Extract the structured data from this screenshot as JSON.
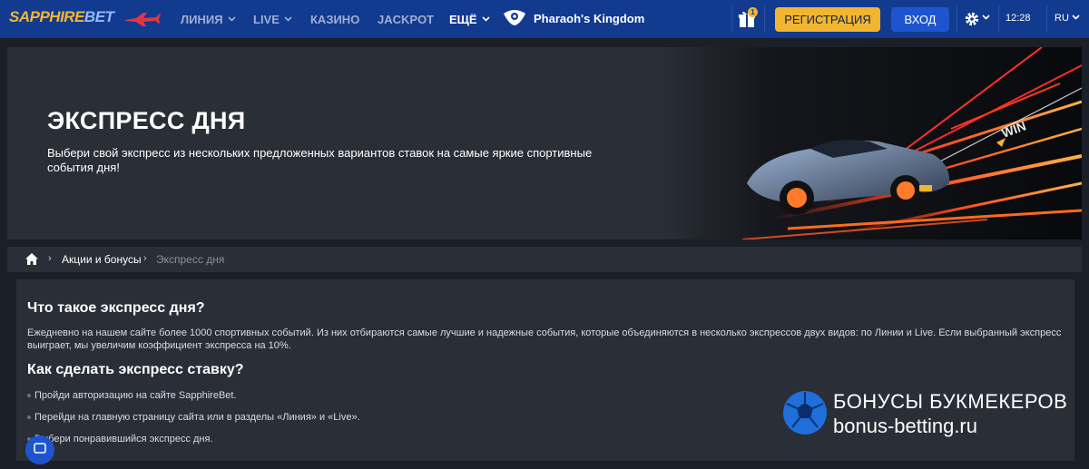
{
  "header": {
    "logo_brand": "SAPPHIRE",
    "logo_suffix": "BET",
    "nav": [
      {
        "label": "ЛИНИЯ",
        "dropdown": true
      },
      {
        "label": "LIVE",
        "dropdown": true
      },
      {
        "label": "КАЗИНО",
        "dropdown": false
      },
      {
        "label": "JACKPOT",
        "dropdown": false
      },
      {
        "label": "ЕЩЁ",
        "dropdown": true
      }
    ],
    "featured_game": "Pharaoh's Kingdom",
    "gift_badge": "1",
    "register_label": "РЕГИСТРАЦИЯ",
    "login_label": "ВХОД",
    "time": "12:28",
    "language": "RU",
    "colors": {
      "bar": "#123a8e",
      "register": "#f2b52f",
      "login": "#1e55cf"
    }
  },
  "hero": {
    "title": "ЭКСПРЕСС ДНЯ",
    "subtitle": "Выбери свой экспресс из нескольких предложенных вариантов ставок на самые яркие спортивные события дня!",
    "art_text": "WIN"
  },
  "breadcrumb": {
    "items": [
      "Акции и бонусы",
      "Экспресс дня"
    ]
  },
  "content": {
    "heading1": "Что такое экспресс дня?",
    "paragraph1": "Ежедневно на нашем сайте более 1000 спортивных событий. Из них отбираются самые лучшие и надежные события, которые объединяются в несколько экспрессов двух видов: по Линии и Live. Если выбранный экспресс выиграет, мы увеличим коэффициент экспресса на 10%.",
    "heading2": "Как сделать экспресс ставку?",
    "steps": [
      "Пройди авторизацию на сайте SapphireBet.",
      "Перейди на главную страницу сайта или в разделы «Линия» и «Live».",
      "Выбери понравившийся экспресс дня."
    ]
  },
  "watermark": {
    "line1": "БОНУСЫ БУКМЕКЕРОВ",
    "line2": "bonus-betting.ru"
  }
}
